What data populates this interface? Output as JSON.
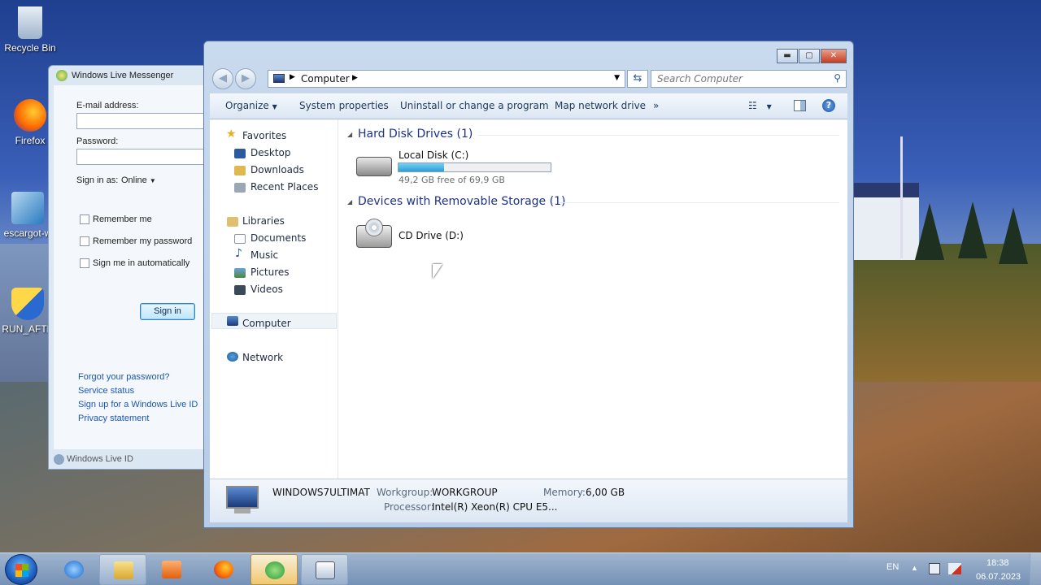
{
  "colors": {
    "accent": "#1e3287",
    "link": "#1a56b8",
    "bar_fill": "#26a0da"
  },
  "desktop": {
    "icons": [
      {
        "label": "Recycle Bin",
        "icon": "recycle-bin-icon"
      },
      {
        "label": "Firefox",
        "icon": "firefox-icon"
      },
      {
        "label": "escargot-w",
        "icon": "installer-icon"
      },
      {
        "label": "RUN_AFTE",
        "icon": "shield-shortcut-icon"
      }
    ]
  },
  "messenger": {
    "title": "Windows Live Messenger",
    "email_label": "E-mail address:",
    "email_value": "",
    "password_label": "Password:",
    "password_value": "",
    "signin_as_label": "Sign in as:",
    "status_value": "Online",
    "remember_me": "Remember me",
    "remember_password": "Remember my password",
    "sign_in_auto": "Sign me in automatically",
    "signin_button": "Sign in",
    "links": [
      "Forgot your password?",
      "Service status",
      "Sign up for a Windows Live ID",
      "Privacy statement"
    ],
    "footer": "Windows Live ID"
  },
  "explorer": {
    "caption": {
      "minimize": "▬",
      "maximize": "▢",
      "close": "✕"
    },
    "address": {
      "crumb": "Computer"
    },
    "search": {
      "placeholder": "Search Computer"
    },
    "toolbar": {
      "organize": "Organize",
      "system_properties": "System properties",
      "uninstall": "Uninstall or change a program",
      "map_drive": "Map network drive",
      "more": "»"
    },
    "nav": {
      "favorites": "Favorites",
      "desktop": "Desktop",
      "downloads": "Downloads",
      "recent": "Recent Places",
      "libraries": "Libraries",
      "documents": "Documents",
      "music": "Music",
      "pictures": "Pictures",
      "videos": "Videos",
      "computer": "Computer",
      "network": "Network"
    },
    "groups": {
      "hard_disk": "Hard Disk Drives (1)",
      "removable": "Devices with Removable Storage (1)"
    },
    "drives": {
      "c_label": "Local Disk (C:)",
      "c_free": "49,2 GB free of 69,9 GB",
      "c_used_fraction": 0.3,
      "d_label": "CD Drive (D:)"
    },
    "details": {
      "computer_name": "WINDOWS7ULTIMAT",
      "workgroup_key": "Workgroup:",
      "workgroup_value": "WORKGROUP",
      "memory_key": "Memory:",
      "memory_value": "6,00 GB",
      "processor_key": "Processor:",
      "processor_value": "Intel(R) Xeon(R) CPU E5..."
    }
  },
  "taskbar": {
    "language": "EN",
    "time": "18:38",
    "date": "06.07.2023"
  }
}
